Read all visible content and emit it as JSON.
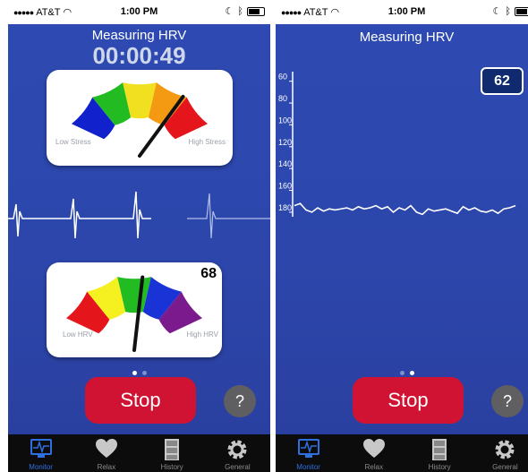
{
  "status_bar": {
    "carrier": "AT&T",
    "time": "1:00 PM"
  },
  "screen_left": {
    "title": "Measuring HRV",
    "timer": "00:00:49",
    "stress_gauge": {
      "low_label": "Low Stress",
      "high_label": "High Stress",
      "level": 0.78
    },
    "hrv_gauge": {
      "low_label": "Low HRV",
      "high_label": "High HRV",
      "value": "68",
      "level": 0.55
    },
    "page": 1,
    "stop_label": "Stop",
    "help_label": "?"
  },
  "screen_right": {
    "title": "Measuring HRV",
    "current_value": "62",
    "y_ticks": [
      "180",
      "160",
      "140",
      "120",
      "100",
      "80",
      "60"
    ],
    "page": 2,
    "stop_label": "Stop",
    "help_label": "?"
  },
  "tabs": [
    {
      "label": "Monitor",
      "icon": "monitor-icon",
      "active": true
    },
    {
      "label": "Relax",
      "icon": "heart-icon",
      "active": false
    },
    {
      "label": "History",
      "icon": "filing-cabinet-icon",
      "active": false
    },
    {
      "label": "General",
      "icon": "gear-icon",
      "active": false
    }
  ],
  "colors": {
    "background": "#2e4bb3",
    "stop": "#d01332",
    "active_tab": "#2f6fe0",
    "badge": "#0f2a6e"
  },
  "chart_data": {
    "type": "line",
    "ylim": [
      55,
      185
    ],
    "y_ticks": [
      60,
      80,
      100,
      120,
      140,
      160,
      180
    ],
    "series": [
      {
        "values": [
          66,
          68,
          62,
          60,
          64,
          61,
          63,
          62,
          63,
          64,
          62,
          65,
          63,
          64,
          66,
          63,
          65,
          60,
          64,
          62,
          66,
          60,
          58,
          63,
          61,
          62,
          63,
          61,
          59,
          65,
          62,
          64,
          61,
          60,
          62,
          59,
          63,
          64,
          66
        ]
      }
    ]
  }
}
